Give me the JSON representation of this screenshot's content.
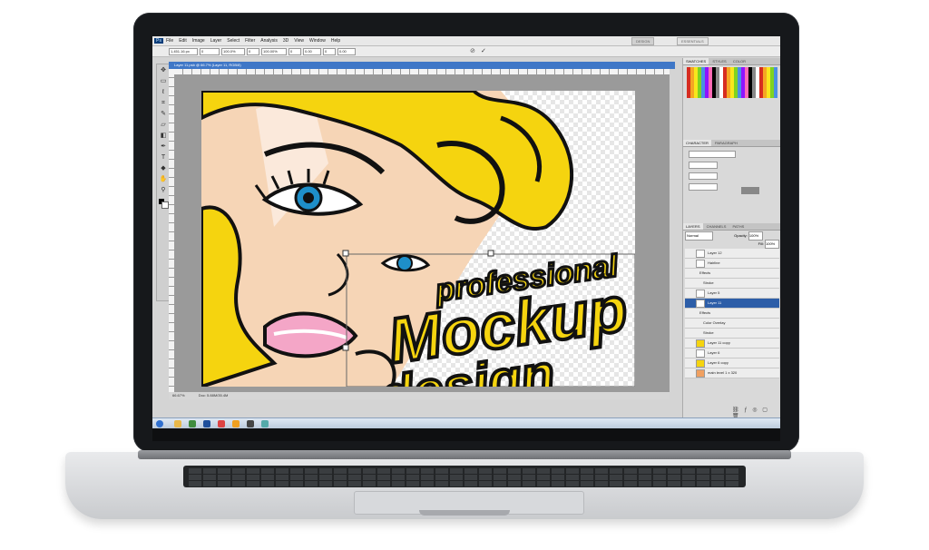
{
  "app": {
    "menus": [
      "File",
      "Edit",
      "Image",
      "Layer",
      "Select",
      "Filter",
      "Analysis",
      "3D",
      "View",
      "Window",
      "Help"
    ],
    "workspace": [
      "DESIGN",
      "ESSENTIALS"
    ],
    "options_fields": [
      "1,451.16 px",
      "0",
      "100.0%",
      "0",
      "100.00%",
      "0",
      "0.00",
      "0",
      "0.00"
    ],
    "document_tab": "Layer 11.psb @ 66.7% (Layer 11, RGB/8)",
    "status": "Doc: 5.88M/35.4M",
    "zoom": "66.67%"
  },
  "artwork": {
    "line1": "professional",
    "line2": "Mockup",
    "line3": "design",
    "palette": {
      "yellow": "#f5d40f",
      "skin": "#f6d5b6",
      "outline": "#111111",
      "eye": "#1e8fc9",
      "lip": "#f4a6c7"
    }
  },
  "panels": {
    "tabs_top": [
      "SWATCHES",
      "STYLES",
      "COLOR"
    ],
    "tabs_mid": [
      "CHARACTER",
      "PARAGRAPH"
    ],
    "tabs_layers": [
      "LAYERS",
      "CHANNELS",
      "PATHS"
    ],
    "blend_mode": "Normal",
    "opacity_label": "Opacity:",
    "opacity": "100%",
    "fill_label": "Fill:",
    "fill": "100%",
    "layers": [
      {
        "name": "Layer 12",
        "selected": false
      },
      {
        "name": "Hairline",
        "selected": false
      },
      {
        "name": "Effects",
        "selected": false
      },
      {
        "name": "Stroke",
        "selected": false
      },
      {
        "name": "Layer 5",
        "selected": false
      },
      {
        "name": "Layer 11",
        "selected": true
      },
      {
        "name": "Effects",
        "selected": false
      },
      {
        "name": "Color Overlay",
        "selected": false
      },
      {
        "name": "Stroke",
        "selected": false
      },
      {
        "name": "Layer 11 copy",
        "selected": false
      },
      {
        "name": "Layer 6",
        "selected": false
      },
      {
        "name": "Layer 6 copy",
        "selected": false
      },
      {
        "name": "main level 1 x 320",
        "selected": false
      }
    ]
  },
  "icons": [
    "move-tool-icon",
    "marquee-tool-icon",
    "lasso-tool-icon",
    "crop-tool-icon",
    "brush-tool-icon",
    "eraser-tool-icon",
    "text-tool-icon",
    "zoom-tool-icon",
    "hand-tool-icon",
    "eye-icon"
  ]
}
